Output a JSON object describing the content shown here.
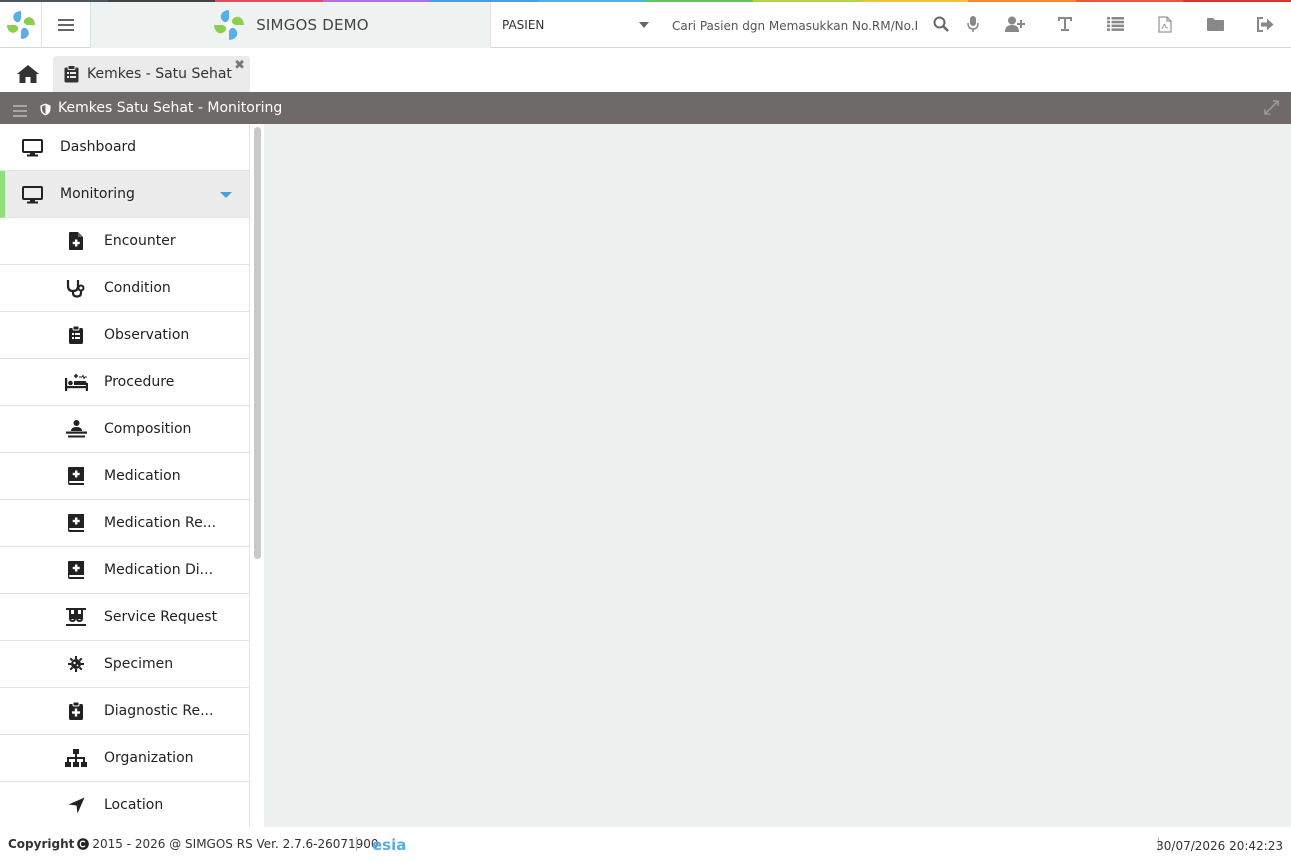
{
  "app": {
    "brand_name": "SIMGOS DEMO",
    "colors": {
      "rainbow": [
        "#4a5560",
        "#444",
        "#e04f5f",
        "#ad73e0",
        "#4f9de0",
        "#4fb3e0",
        "#65c35f",
        "#b5d34a",
        "#f0c23a",
        "#f08a3a",
        "#e8573f",
        "#d9352a"
      ],
      "header_bar": "#6e6a6a",
      "active_accent": "#8ee07a",
      "dropdown_caret": "#4a9ddb",
      "content_bg": "#edf1f0"
    }
  },
  "topbar": {
    "patient_select_value": "PASIEN",
    "search_placeholder": "Cari Pasien dgn Memasukkan No.RM/No.K",
    "tools": [
      "search-icon",
      "microphone-icon",
      "add-user-icon",
      "text-icon",
      "list-icon",
      "pdf-icon",
      "folder-icon",
      "logout-icon"
    ]
  },
  "tabs": {
    "home_icon": "home-icon",
    "items": [
      {
        "label": "Kemkes - Satu Sehat",
        "icon": "clipboard-icon",
        "close": "✖"
      }
    ]
  },
  "header": {
    "title": "Kemkes Satu Sehat - Monitoring"
  },
  "sidebar": {
    "items": [
      {
        "label": "Dashboard",
        "icon": "monitor-icon"
      },
      {
        "label": "Monitoring",
        "icon": "monitor-icon",
        "active": true
      }
    ],
    "sub_items": [
      {
        "label": "Encounter",
        "icon": "file-medical-icon"
      },
      {
        "label": "Condition",
        "icon": "stethoscope-icon"
      },
      {
        "label": "Observation",
        "icon": "clipboard-list-icon"
      },
      {
        "label": "Procedure",
        "icon": "procedure-bed-icon"
      },
      {
        "label": "Composition",
        "icon": "patient-icon"
      },
      {
        "label": "Medication",
        "icon": "medical-book-icon"
      },
      {
        "label": "Medication Re...",
        "icon": "medical-book-icon"
      },
      {
        "label": "Medication Di...",
        "icon": "medical-book-icon"
      },
      {
        "label": "Service Request",
        "icon": "test-tubes-icon"
      },
      {
        "label": "Specimen",
        "icon": "virus-icon"
      },
      {
        "label": "Diagnostic Re...",
        "icon": "clipboard-plus-icon"
      },
      {
        "label": "Organization",
        "icon": "sitemap-icon"
      },
      {
        "label": "Location",
        "icon": "location-arrow-icon"
      }
    ]
  },
  "footer": {
    "copyright_label": "Copyright",
    "copyright_text": "2015 - 2026 @ SIMGOS RS Ver. 2.7.6-26071900",
    "marquee_text": "esia",
    "datetime": "30/07/2026 20:42:23"
  }
}
